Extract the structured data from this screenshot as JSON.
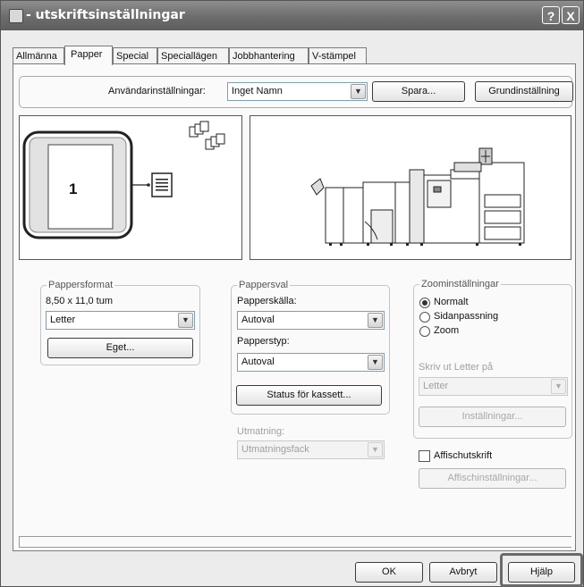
{
  "window": {
    "title": "- utskriftsinställningar",
    "help_glyph": "?",
    "close_glyph": "X"
  },
  "tabs": [
    {
      "label": "Allmänna",
      "active": false
    },
    {
      "label": "Papper",
      "active": true
    },
    {
      "label": "Special",
      "active": false
    },
    {
      "label": "Speciallägen",
      "active": false
    },
    {
      "label": "Jobbhantering",
      "active": false
    },
    {
      "label": "V-stämpel",
      "active": false
    }
  ],
  "user_settings": {
    "label": "Användarinställningar:",
    "value": "Inget Namn",
    "save_button": "Spara...",
    "default_button": "Grundinställning"
  },
  "preview": {
    "page_number": "1"
  },
  "paper_size": {
    "title": "Pappersformat",
    "dimensions": "8,50 x 11,0 tum",
    "value": "Letter",
    "custom_button": "Eget..."
  },
  "paper_selection": {
    "title": "Pappersval",
    "source_label": "Papperskälla:",
    "source_value": "Autoval",
    "type_label": "Papperstyp:",
    "type_value": "Autoval",
    "tray_status_button": "Status för kassett..."
  },
  "output": {
    "label": "Utmatning:",
    "value": "Utmatningsfack"
  },
  "zoom": {
    "title": "Zoominställningar",
    "options": [
      "Normalt",
      "Sidanpassning",
      "Zoom"
    ],
    "selected": "Normalt",
    "print_on_label": "Skriv ut Letter på",
    "print_on_value": "Letter",
    "settings_button": "Inställningar..."
  },
  "poster": {
    "checkbox_label": "Affischutskrift",
    "checked": false,
    "settings_button": "Affischinställningar..."
  },
  "footer": {
    "ok": "OK",
    "cancel": "Avbryt",
    "help": "Hjälp"
  }
}
